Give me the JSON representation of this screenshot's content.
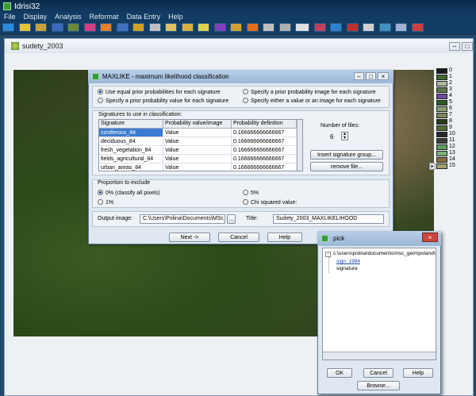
{
  "app": {
    "title": "Idrisi32"
  },
  "menu": [
    "File",
    "Display",
    "Analysis",
    "Reformat",
    "Data Entry",
    "Help"
  ],
  "document": {
    "title": "sudety_2003"
  },
  "legend": {
    "labels": [
      "0",
      "1",
      "2",
      "3",
      "4",
      "5",
      "6",
      "7",
      "8",
      "9",
      "10",
      "11",
      "12",
      "13",
      "14",
      "15"
    ],
    "colors": [
      "#1a1a1a",
      "#3d6b2a",
      "#b0b8a0",
      "#5a7848",
      "#6b4f9a",
      "#2e5a2a",
      "#8aa070",
      "#7a8a5a",
      "#243a1a",
      "#506a34",
      "#2a2a2a",
      "#3a3a3a",
      "#5aa05a",
      "#7ab07a",
      "#8a6a3a",
      "#a0a070"
    ]
  },
  "maxlike": {
    "title": "MAXLIKE - maximum likelihood classification",
    "options": [
      "Use equal prior probabilities for each signature",
      "Specify a prior probability image for each signature",
      "Specify a prior probability value for each signature",
      "Specify either a value or an image for each signature"
    ],
    "signatures_label": "Signatures to use in classification:",
    "columns": [
      "Signature",
      "Probability value/image",
      "Probability definition"
    ],
    "rows": [
      [
        "coniferous_84",
        "Value",
        "0.166666666666667"
      ],
      [
        "deciduous_84",
        "Value",
        "0.166666666666667"
      ],
      [
        "fresh_vegetation_84",
        "Value",
        "0.166666666666667"
      ],
      [
        "fields_agricultural_84",
        "Value",
        "0.166666666666667"
      ],
      [
        "urban_areas_84",
        "Value",
        "0.166666666666667"
      ]
    ],
    "num_files_label": "Number of files:",
    "num_files": "6",
    "insert_button": "Insert signature group...",
    "remove_button": "remove file...",
    "proportion_label": "Proportion to exclude",
    "proportion_options": [
      "0% (classify all pixels)",
      "5%",
      "1%",
      "Chi squared value:"
    ],
    "output_label": "Output image:",
    "output_value": "C:\\Users\\Polina\\Documents\\MSc_G",
    "browse_button": "...",
    "title_label": "Title:",
    "title_value": "Sudety_2003_MAXLIKELIHOOD",
    "next_button": "Next ->",
    "cancel_button": "Cancel",
    "help_button": "Help"
  },
  "pick": {
    "title": "pick",
    "root": "c:\\users\\polina\\documents\\msc_gem\\poland\\",
    "child1": "sign_1984",
    "child2": "signature",
    "ok": "OK",
    "cancel": "Cancel",
    "help": "Help",
    "browse": "Browse..."
  }
}
